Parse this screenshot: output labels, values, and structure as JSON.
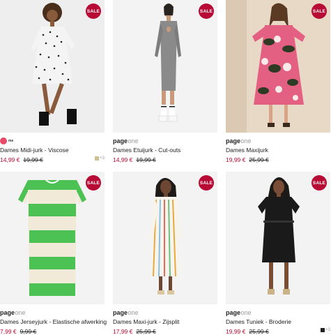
{
  "products": [
    {
      "brand": "",
      "brand_light": "",
      "title": "Dames Midi-jurk - Viscose",
      "price_new": "14,99 €",
      "price_old": "19,99 €",
      "sale": "SALE",
      "swatch_color": "#cdbf94",
      "swatch_more": "+3"
    },
    {
      "brand": "page",
      "brand_light": "one",
      "title": "Dames Etuijurk - Cut-outs",
      "price_new": "14,99 €",
      "price_old": "19,99 €",
      "sale": "SALE"
    },
    {
      "brand": "page",
      "brand_light": "one",
      "title": "Dames Maxijurk",
      "price_new": "19,99 €",
      "price_old": "25,99 €",
      "sale": "SALE"
    },
    {
      "brand": "page",
      "brand_light": "one",
      "title": "Dames Jerseyjurk - Elastische afwerking",
      "price_new": "7,99 €",
      "price_old": "9,99 €",
      "sale": "SALE"
    },
    {
      "brand": "page",
      "brand_light": "one",
      "title": "Dames Maxi-jurk - Zijsplit",
      "price_new": "17,99 €",
      "price_old": "25,99 €",
      "sale": "SALE"
    },
    {
      "brand": "page",
      "brand_light": "one",
      "title": "Dames Tuniek - Broderie",
      "price_new": "19,99 €",
      "price_old": "25,99 €",
      "sale": "SALE",
      "swatch_color": "#222222",
      "swatch_more": "+3"
    }
  ],
  "first_brand_small": "me",
  "colors": {
    "sale": "#b70a35",
    "price": "#b70a35"
  }
}
